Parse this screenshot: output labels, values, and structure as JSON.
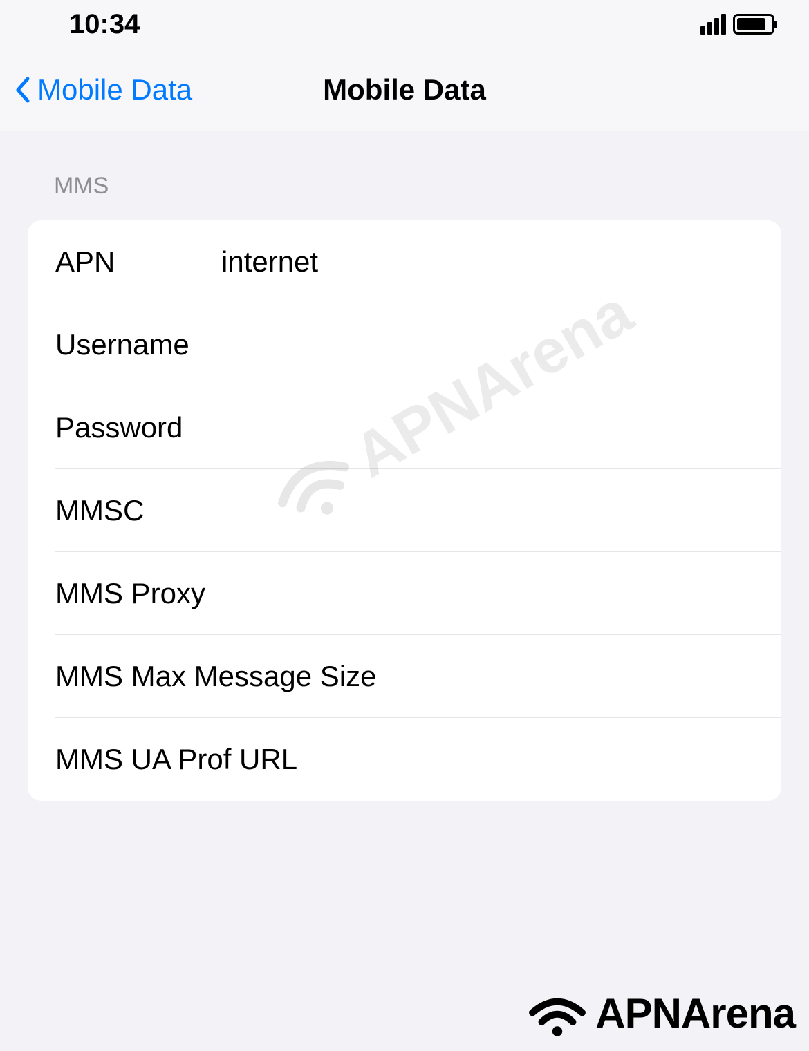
{
  "status_bar": {
    "time": "10:34"
  },
  "nav": {
    "back_label": "Mobile Data",
    "title": "Mobile Data"
  },
  "section": {
    "header": "MMS",
    "rows": {
      "apn": {
        "label": "APN",
        "value": "internet"
      },
      "username": {
        "label": "Username",
        "value": ""
      },
      "password": {
        "label": "Password",
        "value": ""
      },
      "mmsc": {
        "label": "MMSC",
        "value": ""
      },
      "mms_proxy": {
        "label": "MMS Proxy",
        "value": ""
      },
      "mms_max_size": {
        "label": "MMS Max Message Size",
        "value": ""
      },
      "mms_ua_prof": {
        "label": "MMS UA Prof URL",
        "value": ""
      }
    }
  },
  "watermark": {
    "text": "APNArena"
  },
  "footer_logo": {
    "text": "APNArena"
  }
}
